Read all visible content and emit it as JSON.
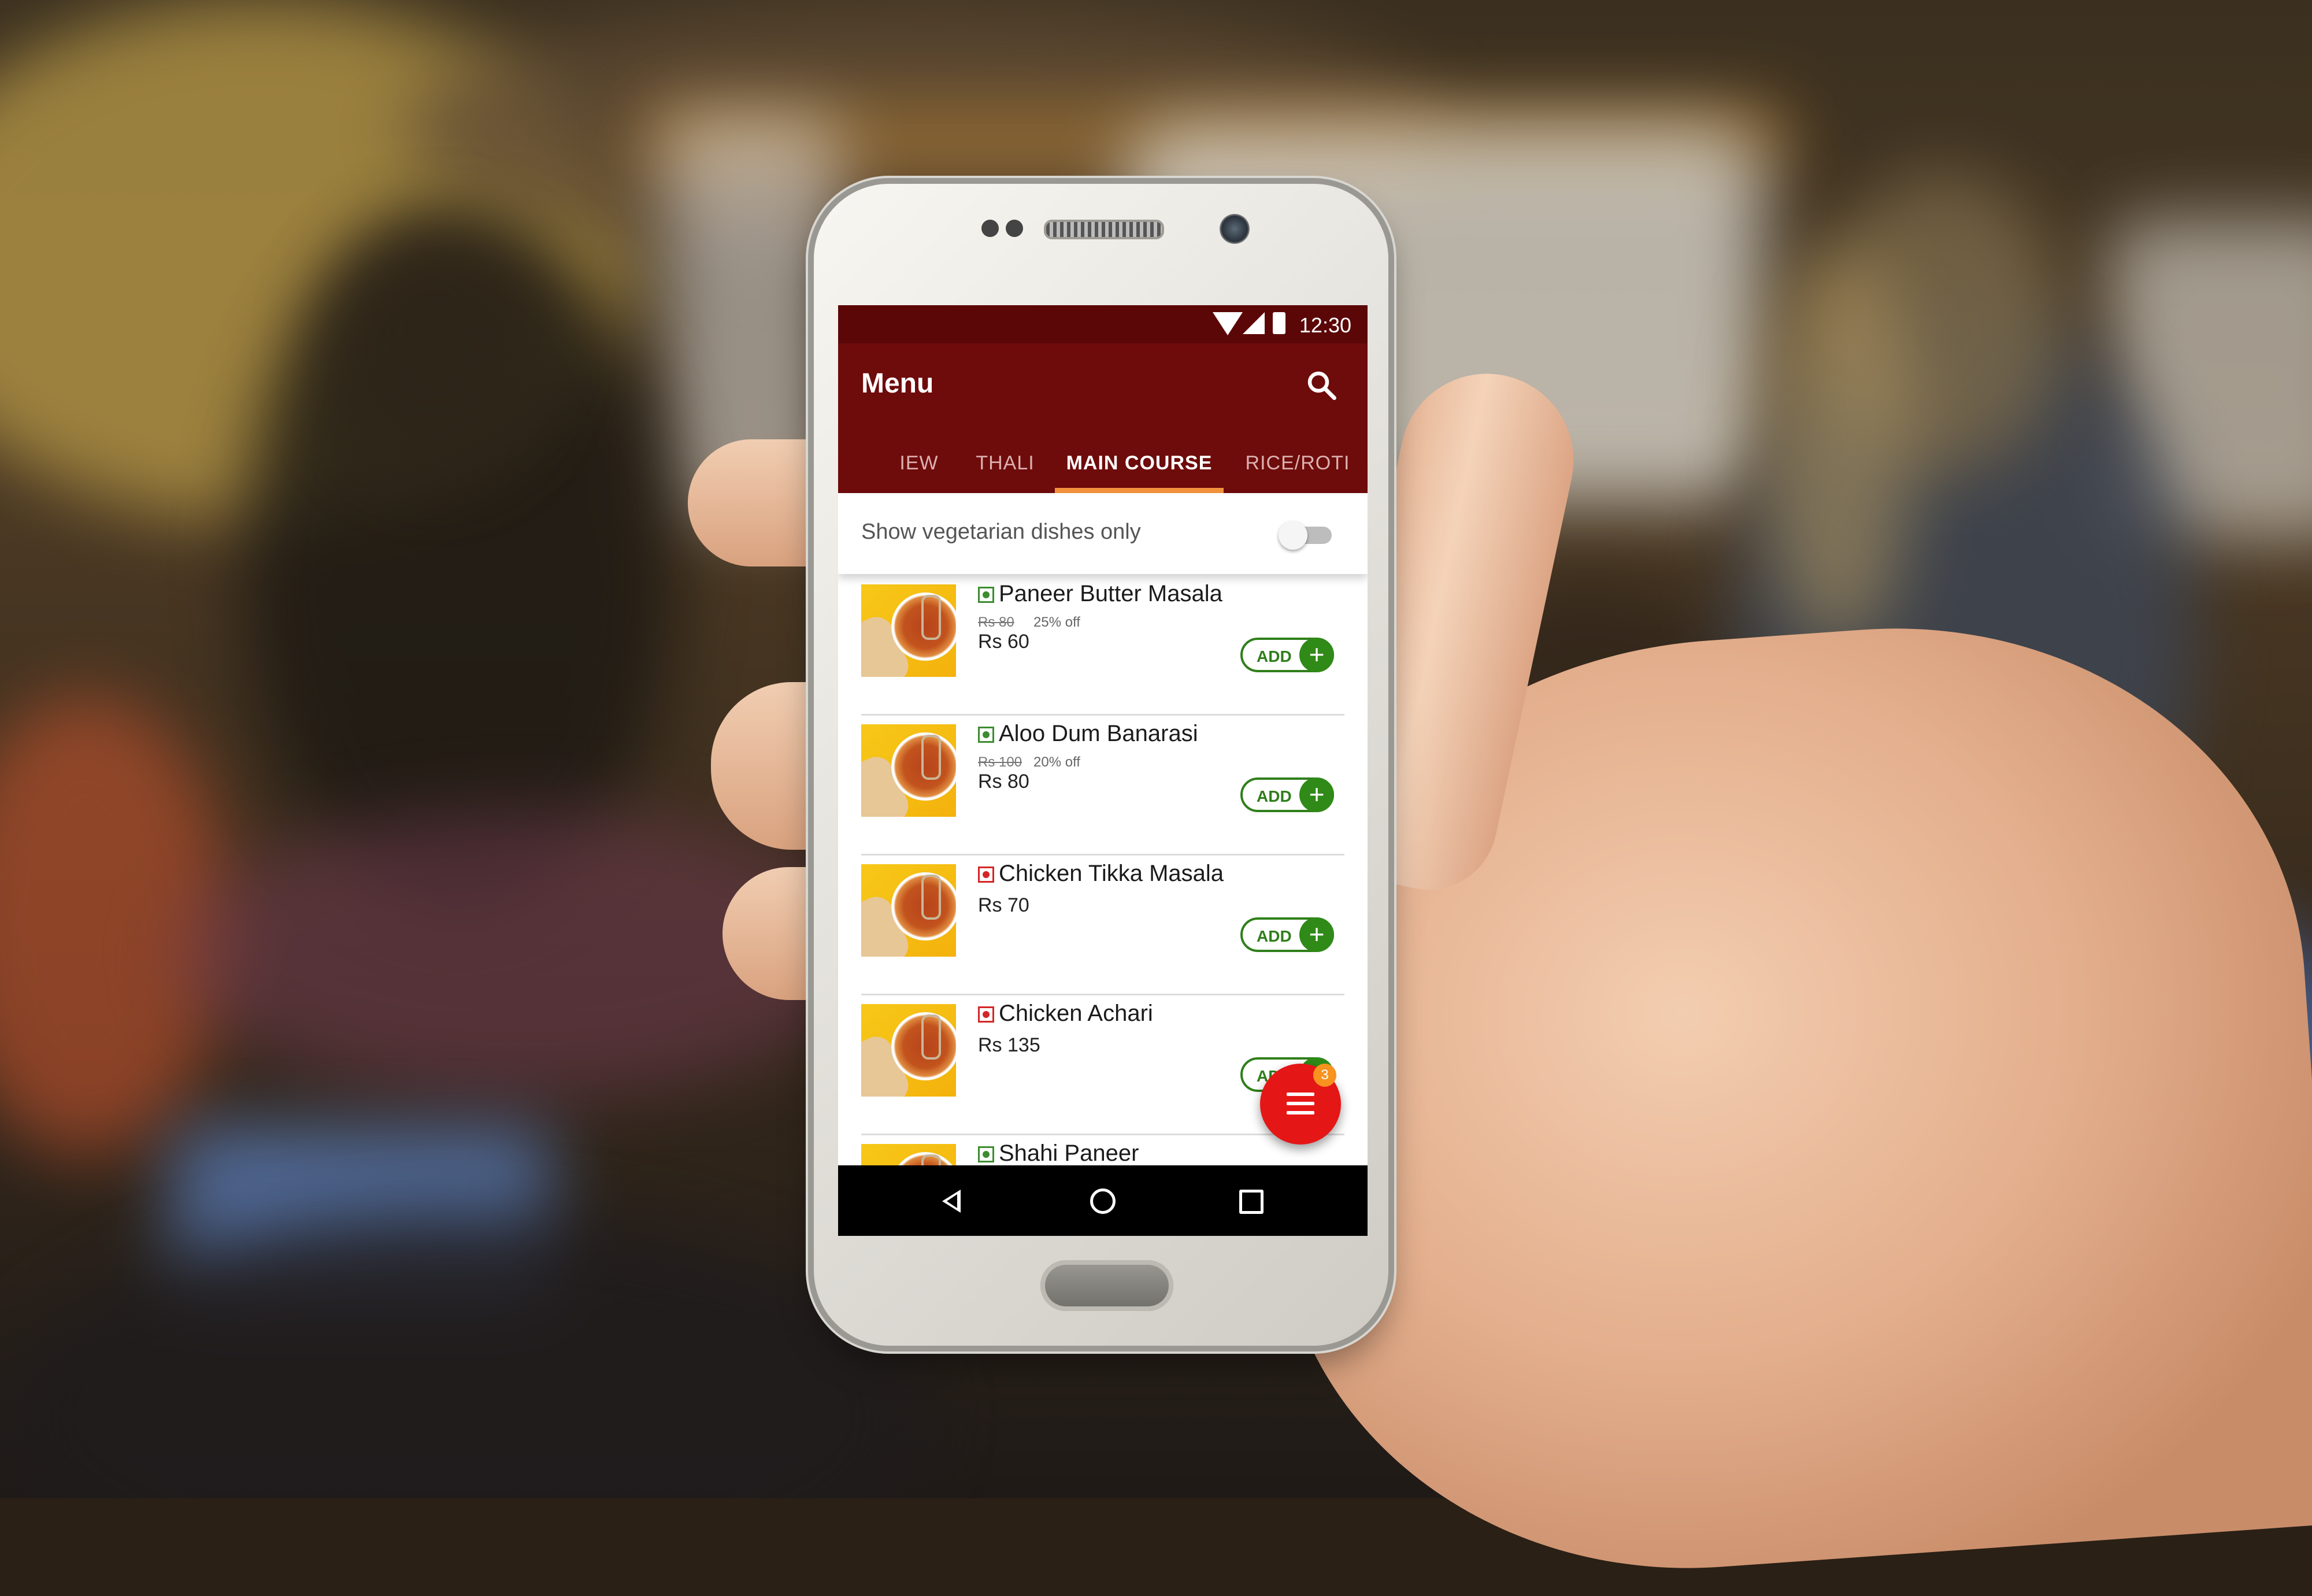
{
  "status_bar": {
    "time": "12:30"
  },
  "app_bar": {
    "title": "Menu"
  },
  "tabs": [
    {
      "label": "IEW",
      "active": false
    },
    {
      "label": "THALI",
      "active": false
    },
    {
      "label": "MAIN COURSE",
      "active": true
    },
    {
      "label": "RICE/ROTI",
      "active": false
    }
  ],
  "filter": {
    "label": "Show vegetarian dishes only",
    "enabled": false
  },
  "dishes": [
    {
      "name": "Paneer Butter Masala",
      "type": "veg",
      "old_price": "Rs 80",
      "discount": "25% off",
      "price": "Rs 60",
      "add_label": "ADD"
    },
    {
      "name": "Aloo Dum Banarasi",
      "type": "veg",
      "old_price": "Rs 100",
      "discount": "20% off",
      "price": "Rs 80",
      "add_label": "ADD"
    },
    {
      "name": "Chicken Tikka Masala",
      "type": "non-veg",
      "price": "Rs 70",
      "add_label": "ADD"
    },
    {
      "name": "Chicken Achari",
      "type": "non-veg",
      "price": "Rs 135",
      "add_label": "ADD"
    },
    {
      "name": "Shahi Paneer",
      "type": "veg"
    }
  ],
  "cart_fab": {
    "count": "3",
    "icon": "menu-lines-icon"
  },
  "colors": {
    "app_bar": "#6e0b0b",
    "tab_indicator": "#f3933d",
    "add_green": "#2f8a17",
    "fab_red": "#e51616",
    "badge_orange": "#f7931e"
  }
}
